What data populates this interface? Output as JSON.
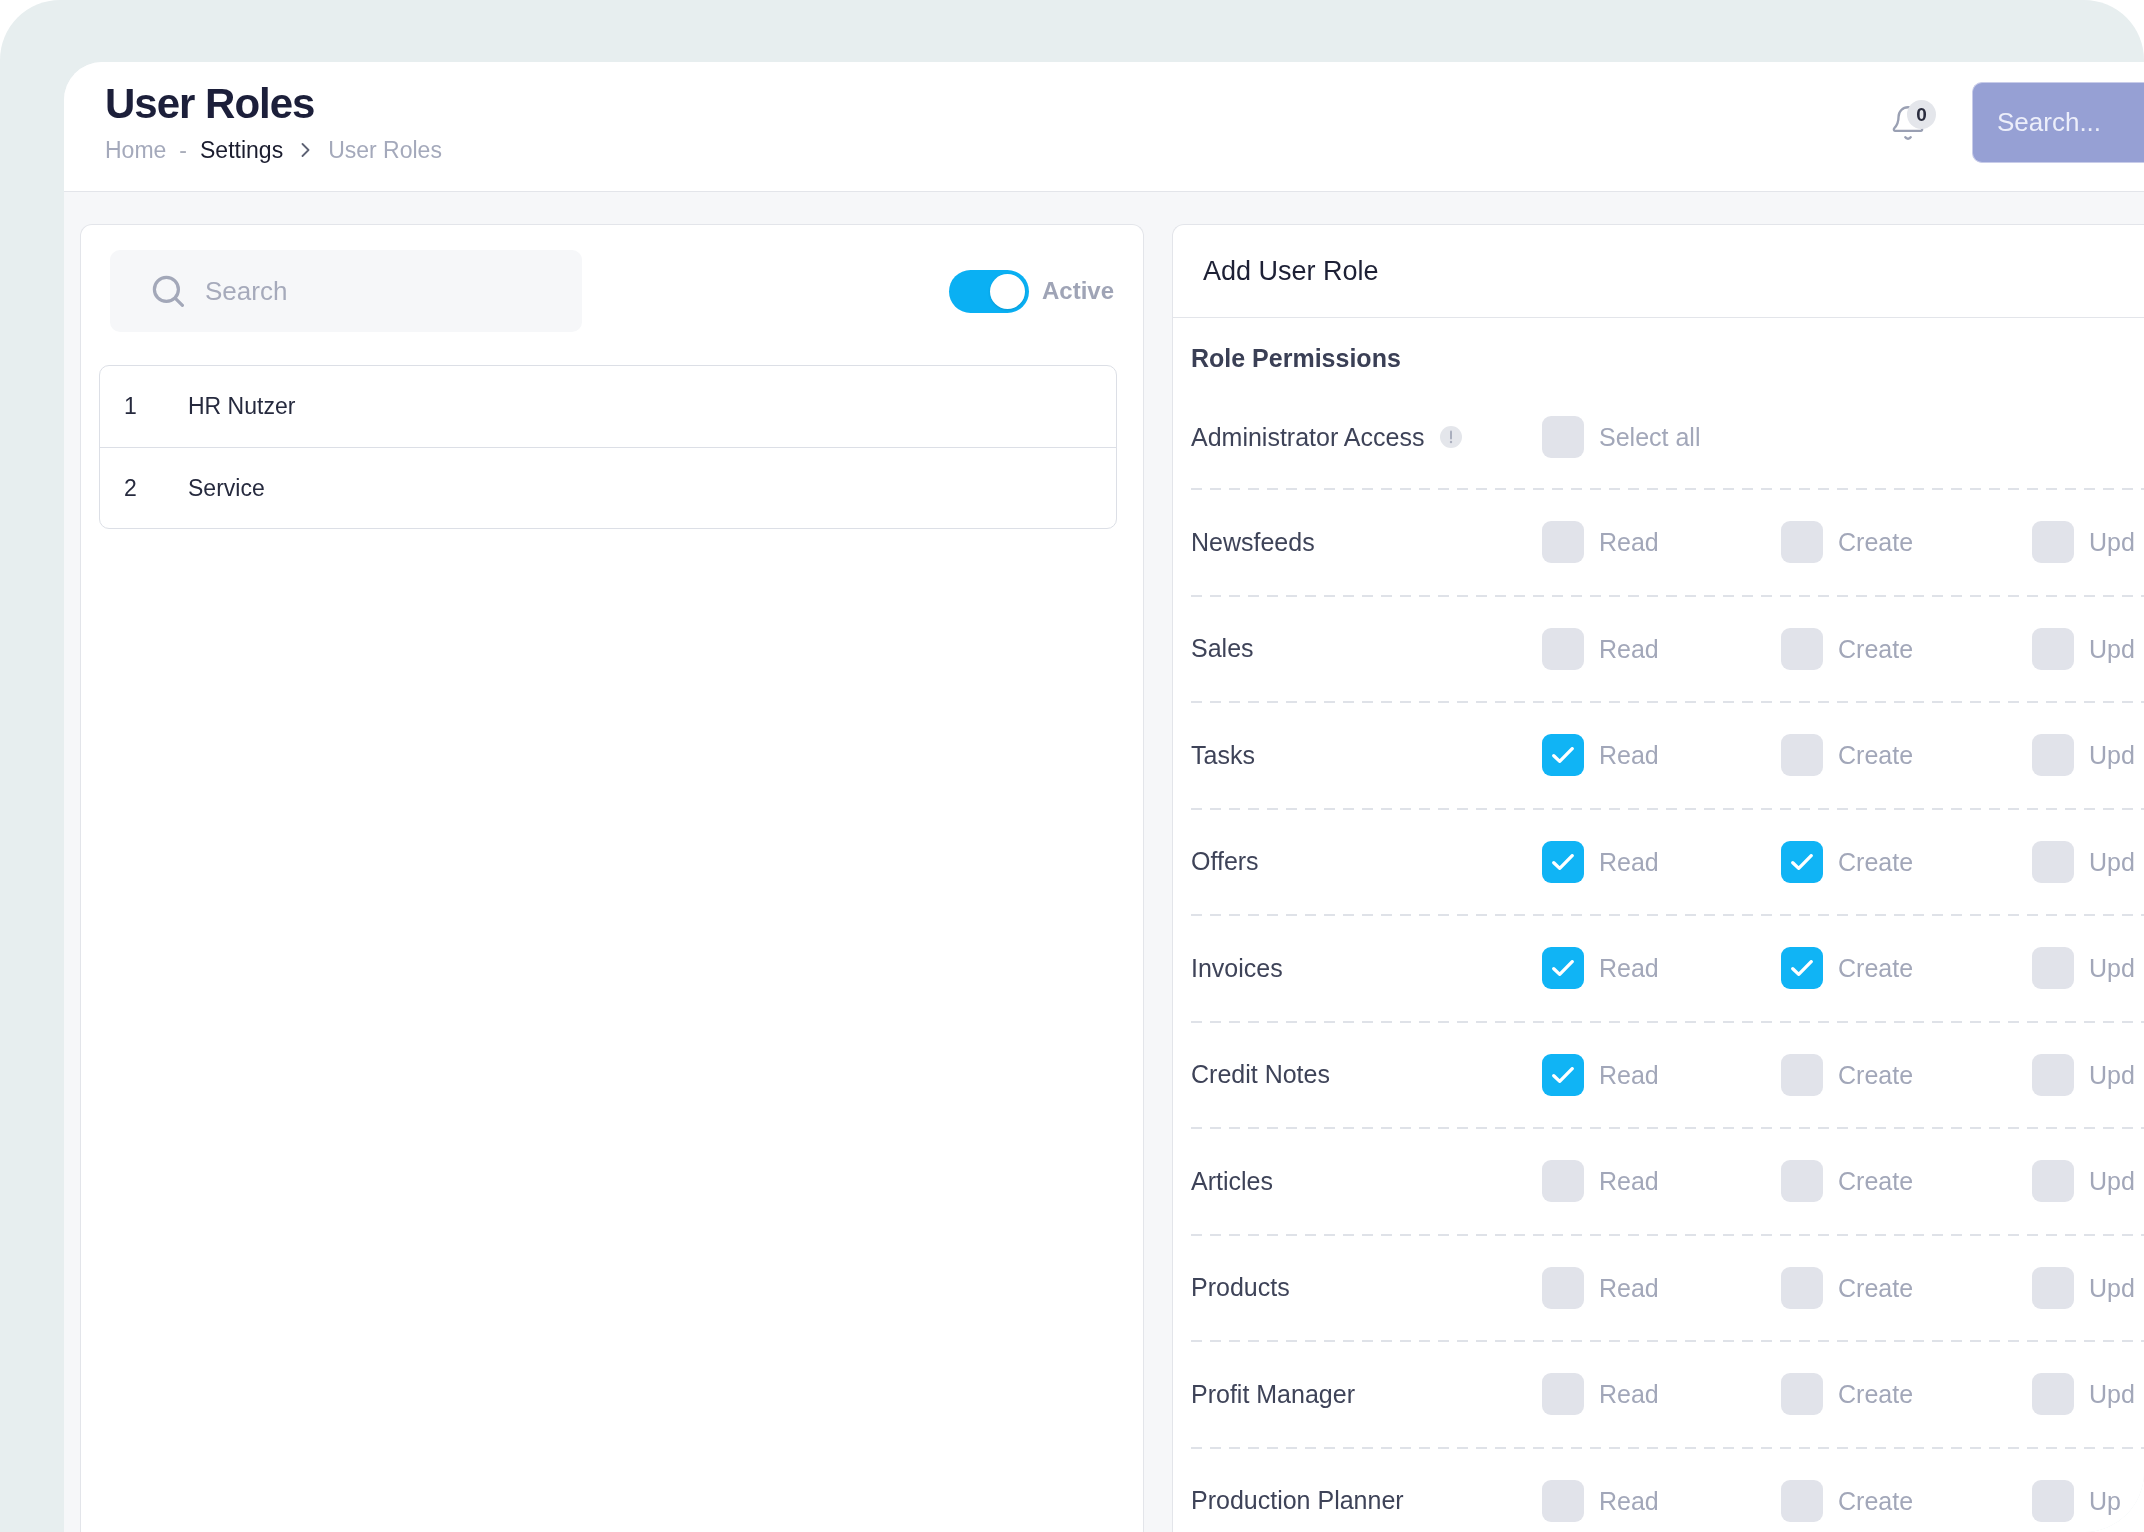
{
  "header": {
    "title": "User Roles",
    "breadcrumb": [
      {
        "kind": "link",
        "label": "Home",
        "active": false
      },
      {
        "kind": "dash",
        "label": "-"
      },
      {
        "kind": "link",
        "label": "Settings",
        "active": true
      },
      {
        "kind": "chevron"
      },
      {
        "kind": "link",
        "label": "User Roles",
        "active": false
      }
    ],
    "notifications": {
      "count": "0"
    },
    "search": {
      "placeholder": "Search..."
    }
  },
  "roles_panel": {
    "search": {
      "placeholder": "Search"
    },
    "active_toggle": {
      "label": "Active",
      "on": true
    },
    "roles": [
      {
        "number": "1",
        "name": "HR Nutzer"
      },
      {
        "number": "2",
        "name": "Service"
      }
    ]
  },
  "form": {
    "title": "Add User Role",
    "section": "Role Permissions",
    "admin": {
      "label": "Administrator Access",
      "select_all": {
        "label": "Select all",
        "checked": false
      }
    },
    "permissions": [
      {
        "name": "Newsfeeds",
        "options": [
          {
            "label": "Read",
            "checked": false
          },
          {
            "label": "Create",
            "checked": false
          },
          {
            "label": "Upd",
            "checked": false
          }
        ]
      },
      {
        "name": "Sales",
        "options": [
          {
            "label": "Read",
            "checked": false
          },
          {
            "label": "Create",
            "checked": false
          },
          {
            "label": "Upd",
            "checked": false
          }
        ]
      },
      {
        "name": "Tasks",
        "options": [
          {
            "label": "Read",
            "checked": true
          },
          {
            "label": "Create",
            "checked": false
          },
          {
            "label": "Upd",
            "checked": false
          }
        ]
      },
      {
        "name": "Offers",
        "options": [
          {
            "label": "Read",
            "checked": true
          },
          {
            "label": "Create",
            "checked": true
          },
          {
            "label": "Upd",
            "checked": false
          }
        ]
      },
      {
        "name": "Invoices",
        "options": [
          {
            "label": "Read",
            "checked": true
          },
          {
            "label": "Create",
            "checked": true
          },
          {
            "label": "Upd",
            "checked": false
          }
        ]
      },
      {
        "name": "Credit Notes",
        "options": [
          {
            "label": "Read",
            "checked": true
          },
          {
            "label": "Create",
            "checked": false
          },
          {
            "label": "Upd",
            "checked": false
          }
        ]
      },
      {
        "name": "Articles",
        "options": [
          {
            "label": "Read",
            "checked": false
          },
          {
            "label": "Create",
            "checked": false
          },
          {
            "label": "Upd",
            "checked": false
          }
        ]
      },
      {
        "name": "Products",
        "options": [
          {
            "label": "Read",
            "checked": false
          },
          {
            "label": "Create",
            "checked": false
          },
          {
            "label": "Upd",
            "checked": false
          }
        ]
      },
      {
        "name": "Profit Manager",
        "options": [
          {
            "label": "Read",
            "checked": false
          },
          {
            "label": "Create",
            "checked": false
          },
          {
            "label": "Upd",
            "checked": false
          }
        ]
      },
      {
        "name": "Production Planner",
        "options": [
          {
            "label": "Read",
            "checked": false
          },
          {
            "label": "Create",
            "checked": false
          },
          {
            "label": "Up",
            "checked": false
          }
        ]
      }
    ]
  }
}
